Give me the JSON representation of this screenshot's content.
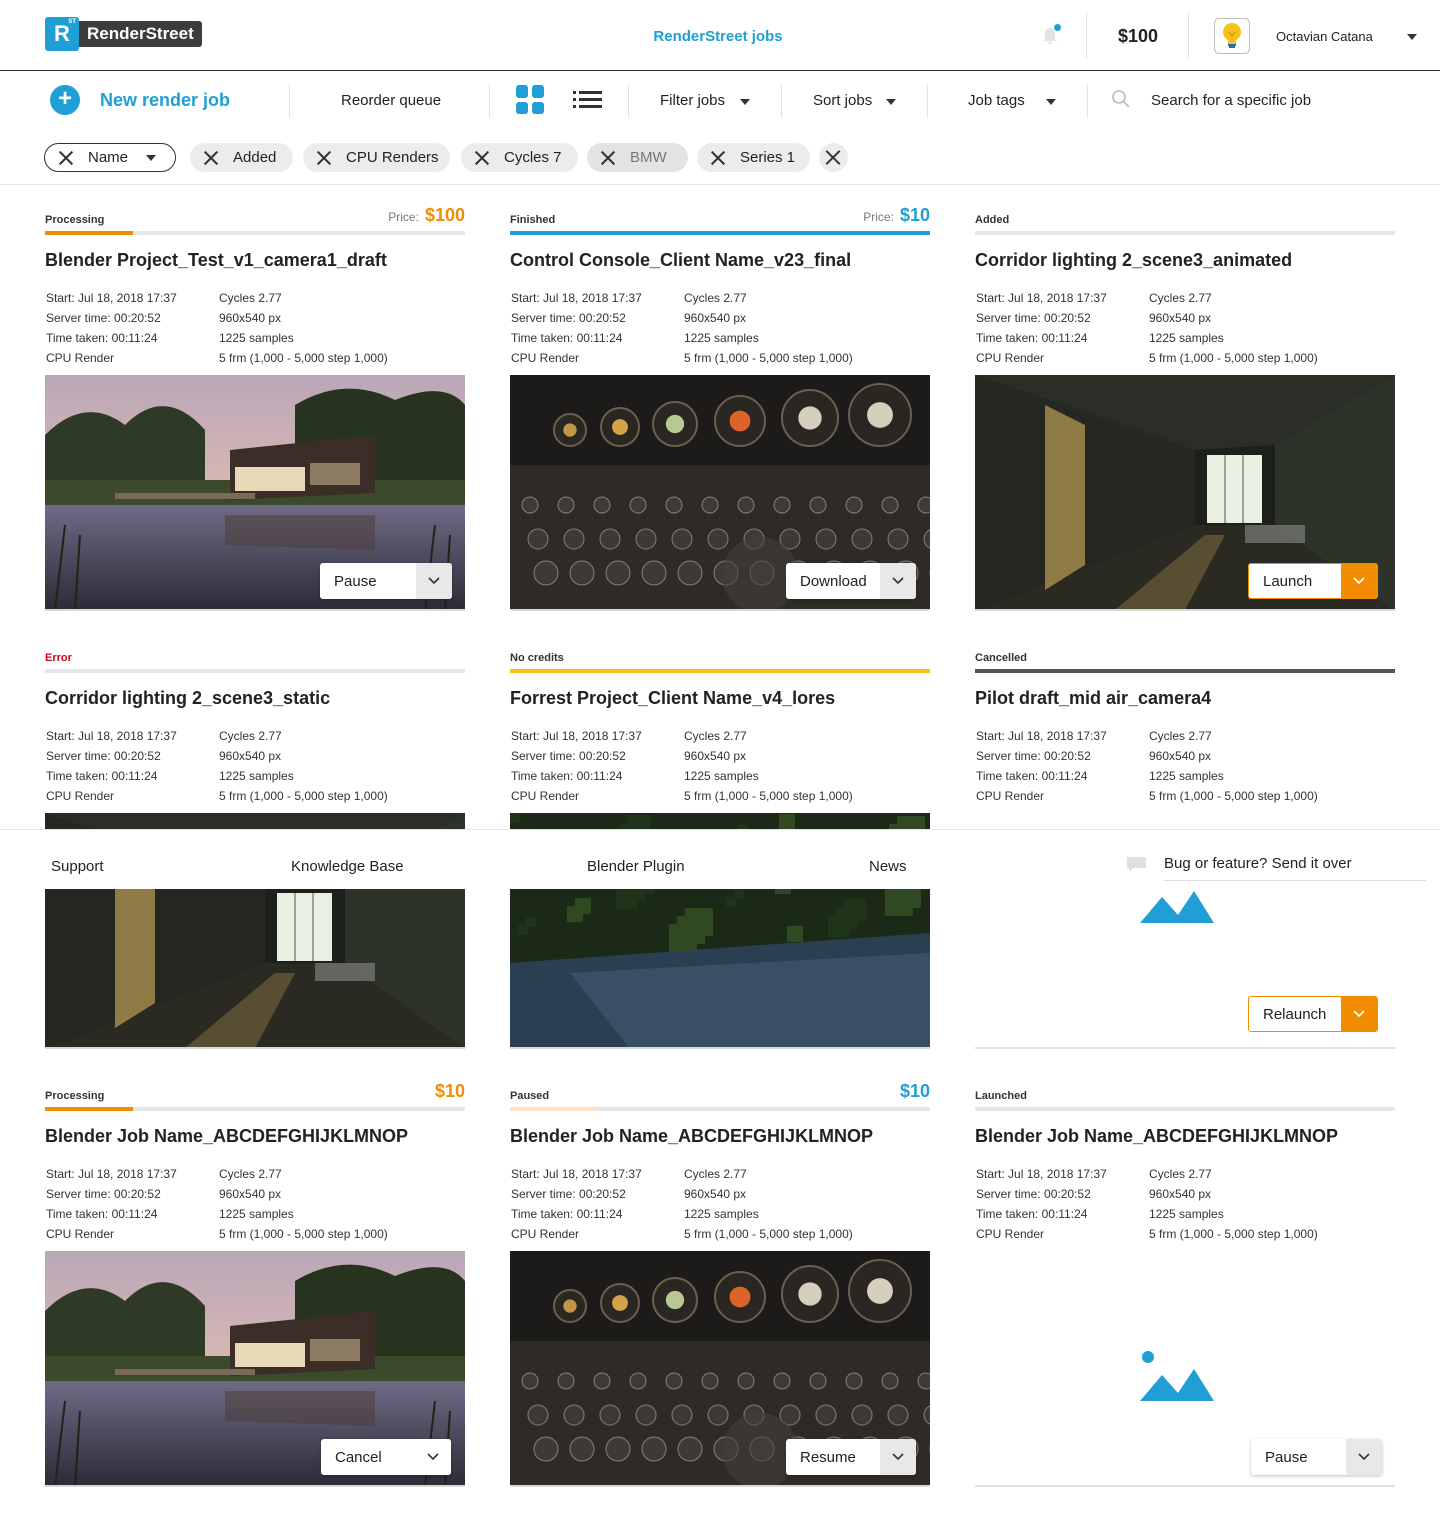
{
  "header": {
    "logo_text": "RenderStreet",
    "logo_mark": "R",
    "logo_superscript": "ST",
    "app_title": "RenderStreet jobs",
    "credit": "$100",
    "user_name": "Octavian Catana",
    "notification_icon": "bell-icon",
    "avatar_icon": "lightbulb-icon"
  },
  "toolbar": {
    "new_job_label": "New render job",
    "reorder_label": "Reorder queue",
    "filter_label": "Filter jobs",
    "sort_label": "Sort jobs",
    "tags_label": "Job tags",
    "search_placeholder": "Search for a specific job"
  },
  "chips": [
    "Name",
    "Added",
    "CPU Renders",
    "Cycles 7",
    "BMW",
    "Series 1"
  ],
  "labels": {
    "price": "Price:",
    "start": "Start:",
    "server": "Server time:",
    "taken": "Time taken:",
    "cpu": "CPU Render"
  },
  "colors": {
    "accent": "#1f9fd6",
    "processing": "#f28c00",
    "finished": "#1f9fd6",
    "no_credits": "#f8c21b",
    "cancelled": "#555555",
    "paused": "#fde2c8",
    "error": "#d0021b"
  },
  "cards": [
    {
      "status": "Processing",
      "price": "$100",
      "price_color": "#f28c00",
      "progress": 0.21,
      "bar_color": "#f28c00",
      "title": "Blender Project_Test_v1_camera1_draft",
      "start": "Jul 18, 2018 17:37",
      "server_time": "00:20:52",
      "time_taken": "00:11:24",
      "engine": "Cycles 2.77",
      "resolution": "960x540 px",
      "samples": "1225 samples",
      "frames": "5 frm (1,000 - 5,000 step 1,000)",
      "action": "Pause",
      "thumb": "lakehouse"
    },
    {
      "status": "Finished",
      "price": "$10",
      "price_color": "#1f9fd6",
      "progress": 1.0,
      "bar_color": "#1f9fd6",
      "title": "Control Console_Client Name_v23_final",
      "start": "Jul 18, 2018 17:37",
      "server_time": "00:20:52",
      "time_taken": "00:11:24",
      "engine": "Cycles 2.77",
      "resolution": "960x540 px",
      "samples": "1225 samples",
      "frames": "5 frm (1,000 - 5,000 step 1,000)",
      "action": "Download",
      "thumb": "console"
    },
    {
      "status": "Added",
      "price": "",
      "progress": 0,
      "bar_color": "#e6e6e6",
      "title": "Corridor lighting 2_scene3_animated",
      "start": "Jul 18, 2018 17:37",
      "server_time": "00:20:52",
      "time_taken": "00:11:24",
      "engine": "Cycles 2.77",
      "resolution": "960x540 px",
      "samples": "1225 samples",
      "frames": "5 frm (1,000 - 5,000 step 1,000)",
      "action": "Launch",
      "thumb": "corridor"
    },
    {
      "status": "Error",
      "price": "",
      "progress": 0,
      "bar_color": "#e6e6e6",
      "title": "Corridor lighting 2_scene3_static",
      "start": "Jul 18, 2018 17:37",
      "server_time": "00:20:52",
      "time_taken": "00:11:24",
      "engine": "Cycles 2.77",
      "resolution": "960x540 px",
      "samples": "1225 samples",
      "frames": "5 frm (1,000 - 5,000 step 1,000)",
      "action": "",
      "thumb": "corridor"
    },
    {
      "status": "No credits",
      "price": "",
      "progress": 1.0,
      "bar_color": "#f8c21b",
      "title": "Forrest Project_Client Name_v4_lores",
      "start": "Jul 18, 2018 17:37",
      "server_time": "00:20:52",
      "time_taken": "00:11:24",
      "engine": "Cycles 2.77",
      "resolution": "960x540 px",
      "samples": "1225 samples",
      "frames": "5 frm (1,000 - 5,000 step 1,000)",
      "action": "",
      "thumb": "forest"
    },
    {
      "status": "Cancelled",
      "price": "",
      "progress": 1.0,
      "bar_color": "#555555",
      "title": "Pilot draft_mid air_camera4",
      "start": "Jul 18, 2018 17:37",
      "server_time": "00:20:52",
      "time_taken": "00:11:24",
      "engine": "Cycles 2.77",
      "resolution": "960x540 px",
      "samples": "1225 samples",
      "frames": "5 frm (1,000 - 5,000 step 1,000)",
      "action": "Relaunch",
      "thumb": "placeholder"
    },
    {
      "status": "Processing",
      "price": "$10",
      "price_color": "#f28c00",
      "progress": 0.21,
      "bar_color": "#f28c00",
      "title": "Blender Job Name_ABCDEFGHIJKLMNOP",
      "start": "Jul 18, 2018 17:37",
      "server_time": "00:20:52",
      "time_taken": "00:11:24",
      "engine": "Cycles 2.77",
      "resolution": "960x540 px",
      "samples": "1225 samples",
      "frames": "5 frm (1,000 - 5,000 step 1,000)",
      "action": "Cancel",
      "thumb": "lakehouse"
    },
    {
      "status": "Paused",
      "price": "$10",
      "price_color": "#1f9fd6",
      "progress": 0.21,
      "bar_color": "#fde2c8",
      "title": "Blender Job Name_ABCDEFGHIJKLMNOP",
      "start": "Jul 18, 2018 17:37",
      "server_time": "00:20:52",
      "time_taken": "00:11:24",
      "engine": "Cycles 2.77",
      "resolution": "960x540 px",
      "samples": "1225 samples",
      "frames": "5 frm (1,000 - 5,000 step 1,000)",
      "action": "Resume",
      "thumb": "console"
    },
    {
      "status": "Launched",
      "price": "",
      "progress": 0,
      "bar_color": "#e6e6e6",
      "title": "Blender Job Name_ABCDEFGHIJKLMNOP",
      "start": "Jul 18, 2018 17:37",
      "server_time": "00:20:52",
      "time_taken": "00:11:24",
      "engine": "Cycles 2.77",
      "resolution": "960x540 px",
      "samples": "1225 samples",
      "frames": "5 frm (1,000 - 5,000 step 1,000)",
      "action": "Pause",
      "thumb": "placeholder"
    }
  ],
  "footer": {
    "support": "Support",
    "knowledge_base": "Knowledge Base",
    "plugin": "Blender Plugin",
    "news": "News",
    "bug": "Bug or feature? Send it over"
  }
}
